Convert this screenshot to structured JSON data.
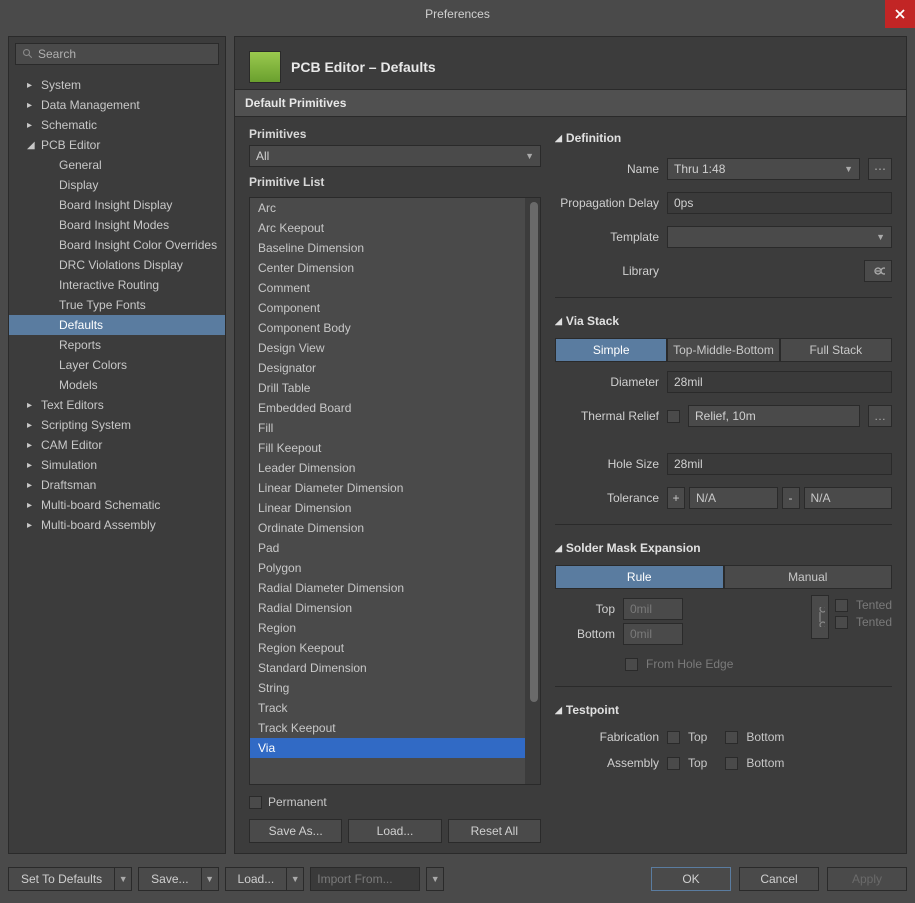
{
  "window": {
    "title": "Preferences"
  },
  "search": {
    "placeholder": "Search"
  },
  "tree": {
    "items": [
      {
        "label": "System",
        "expanded": false
      },
      {
        "label": "Data Management",
        "expanded": false
      },
      {
        "label": "Schematic",
        "expanded": false
      },
      {
        "label": "PCB Editor",
        "expanded": true,
        "children": [
          "General",
          "Display",
          "Board Insight Display",
          "Board Insight Modes",
          "Board Insight Color Overrides",
          "DRC Violations Display",
          "Interactive Routing",
          "True Type Fonts",
          "Defaults",
          "Reports",
          "Layer Colors",
          "Models"
        ],
        "selected_child": 8
      },
      {
        "label": "Text Editors",
        "expanded": false
      },
      {
        "label": "Scripting System",
        "expanded": false
      },
      {
        "label": "CAM Editor",
        "expanded": false
      },
      {
        "label": "Simulation",
        "expanded": false
      },
      {
        "label": "Draftsman",
        "expanded": false
      },
      {
        "label": "Multi-board Schematic",
        "expanded": false
      },
      {
        "label": "Multi-board Assembly",
        "expanded": false
      }
    ]
  },
  "page": {
    "title": "PCB Editor – Defaults",
    "section": "Default Primitives"
  },
  "primitives": {
    "label": "Primitives",
    "filter": "All",
    "list_label": "Primitive List",
    "items": [
      "Arc",
      "Arc Keepout",
      "Baseline Dimension",
      "Center Dimension",
      "Comment",
      "Component",
      "Component Body",
      "Design View",
      "Designator",
      "Drill Table",
      "Embedded Board",
      "Fill",
      "Fill Keepout",
      "Leader Dimension",
      "Linear Diameter Dimension",
      "Linear Dimension",
      "Ordinate Dimension",
      "Pad",
      "Polygon",
      "Radial Diameter Dimension",
      "Radial Dimension",
      "Region",
      "Region Keepout",
      "Standard Dimension",
      "String",
      "Track",
      "Track Keepout",
      "Via"
    ],
    "selected": 27,
    "permanent": "Permanent",
    "save_as": "Save As...",
    "load": "Load...",
    "reset_all": "Reset All"
  },
  "definition": {
    "title": "Definition",
    "name_label": "Name",
    "name_value": "Thru 1:48",
    "prop_delay_label": "Propagation Delay",
    "prop_delay_value": "0ps",
    "template_label": "Template",
    "template_value": "",
    "library_label": "Library"
  },
  "via_stack": {
    "title": "Via Stack",
    "tabs": [
      "Simple",
      "Top-Middle-Bottom",
      "Full Stack"
    ],
    "active_tab": 0,
    "diameter_label": "Diameter",
    "diameter_value": "28mil",
    "thermal_label": "Thermal Relief",
    "thermal_value": "Relief, 10m",
    "hole_label": "Hole Size",
    "hole_value": "28mil",
    "tolerance_label": "Tolerance",
    "tol_plus": "+",
    "tol_plus_val": "N/A",
    "tol_minus": "-",
    "tol_minus_val": "N/A"
  },
  "solder_mask": {
    "title": "Solder Mask Expansion",
    "tabs": [
      "Rule",
      "Manual"
    ],
    "active_tab": 0,
    "top_label": "Top",
    "top_value": "0mil",
    "bottom_label": "Bottom",
    "bottom_value": "0mil",
    "tented": "Tented",
    "from_hole": "From Hole Edge"
  },
  "testpoint": {
    "title": "Testpoint",
    "fab_label": "Fabrication",
    "asm_label": "Assembly",
    "top": "Top",
    "bottom": "Bottom"
  },
  "footer": {
    "set_defaults": "Set To Defaults",
    "save": "Save...",
    "load": "Load...",
    "import": "Import From...",
    "ok": "OK",
    "cancel": "Cancel",
    "apply": "Apply"
  }
}
